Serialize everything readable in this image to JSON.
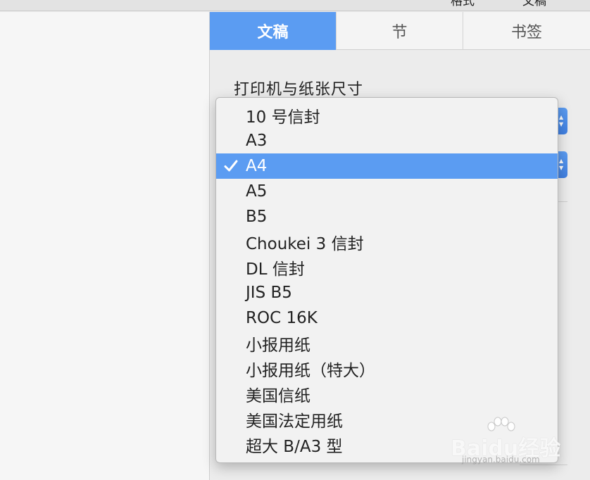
{
  "topbar": {
    "cut_left": "格式",
    "cut_right": "文稿"
  },
  "tabs": [
    {
      "label": "文稿",
      "active": true
    },
    {
      "label": "节",
      "active": false
    },
    {
      "label": "书签",
      "active": false
    }
  ],
  "section_label": "打印机与纸张尺寸",
  "paper_menu": {
    "selected": "A4",
    "items": [
      {
        "label": "10 号信封"
      },
      {
        "label": "A3"
      },
      {
        "label": "A4"
      },
      {
        "label": "A5"
      },
      {
        "label": "B5"
      },
      {
        "label": "Choukei 3 信封"
      },
      {
        "label": "DL 信封"
      },
      {
        "label": "JIS B5"
      },
      {
        "label": "ROC 16K"
      },
      {
        "label": "小报用纸"
      },
      {
        "label": "小报用纸（特大）"
      },
      {
        "label": "美国信纸"
      },
      {
        "label": "美国法定用纸"
      },
      {
        "label": "超大 B/A3 型"
      }
    ]
  },
  "watermark": {
    "brand": "Baidu经验",
    "url": "jingyan.baidu.com"
  },
  "colors": {
    "accent": "#5b9cf2",
    "menu_bg": "#f2f2f2",
    "panel_bg": "#ececec"
  }
}
